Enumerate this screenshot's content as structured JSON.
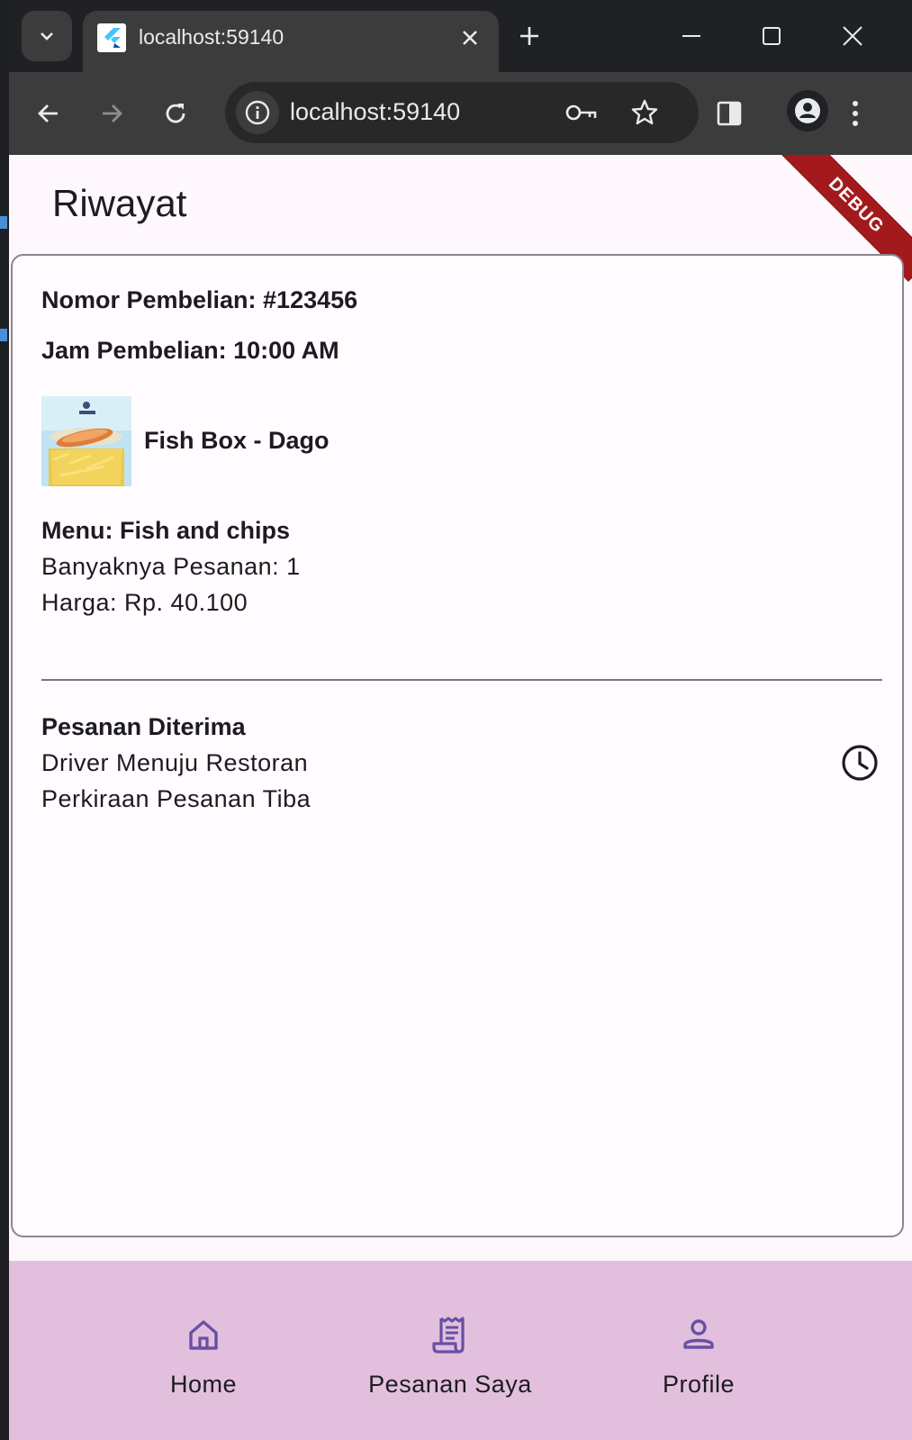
{
  "browser": {
    "tab_title": "localhost:59140",
    "url": "localhost:59140"
  },
  "app": {
    "appbar_title": "Riwayat",
    "debug_banner": "DEBUG",
    "order": {
      "number_line": "Nomor Pembelian: #123456",
      "time_line": "Jam Pembelian: 10:00 AM",
      "restaurant_name": "Fish Box - Dago",
      "menu_line": "Menu: Fish and chips",
      "quantity_line": "Banyaknya Pesanan: 1",
      "price_line": "Harga: Rp. 40.100"
    },
    "status": {
      "title": "Pesanan Diterima",
      "line1": "Driver Menuju Restoran",
      "line2": "Perkiraan Pesanan Tiba",
      "icon": "clock-icon"
    }
  },
  "bottom_nav": {
    "items": [
      {
        "label": "Home",
        "icon": "home-icon"
      },
      {
        "label": "Pesanan Saya",
        "icon": "receipt-icon"
      },
      {
        "label": "Profile",
        "icon": "person-icon"
      }
    ],
    "accent_color": "#6750a4",
    "background": "#e2c0dd"
  }
}
